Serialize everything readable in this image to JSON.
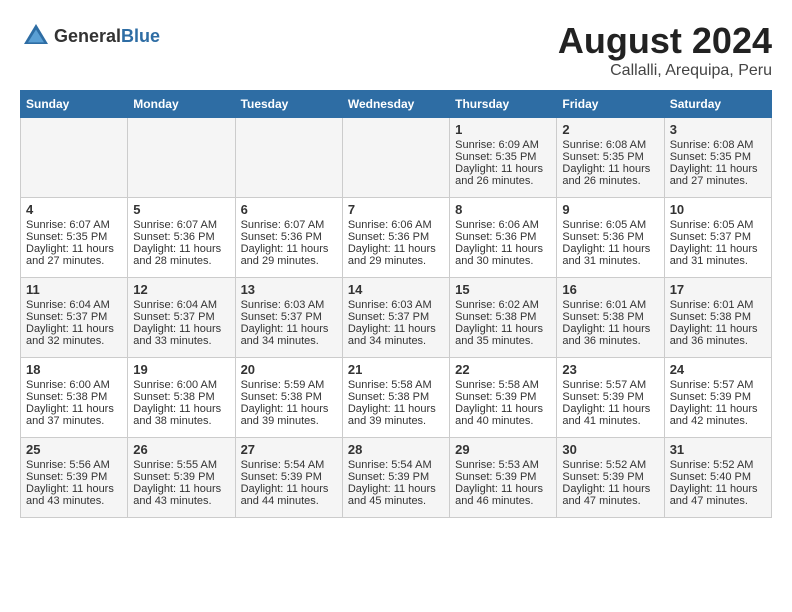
{
  "header": {
    "logo_general": "General",
    "logo_blue": "Blue",
    "month_year": "August 2024",
    "location": "Callalli, Arequipa, Peru"
  },
  "weekdays": [
    "Sunday",
    "Monday",
    "Tuesday",
    "Wednesday",
    "Thursday",
    "Friday",
    "Saturday"
  ],
  "weeks": [
    [
      {
        "day": "",
        "sunrise": "",
        "sunset": "",
        "daylight": ""
      },
      {
        "day": "",
        "sunrise": "",
        "sunset": "",
        "daylight": ""
      },
      {
        "day": "",
        "sunrise": "",
        "sunset": "",
        "daylight": ""
      },
      {
        "day": "",
        "sunrise": "",
        "sunset": "",
        "daylight": ""
      },
      {
        "day": "1",
        "sunrise": "Sunrise: 6:09 AM",
        "sunset": "Sunset: 5:35 PM",
        "daylight": "Daylight: 11 hours and 26 minutes."
      },
      {
        "day": "2",
        "sunrise": "Sunrise: 6:08 AM",
        "sunset": "Sunset: 5:35 PM",
        "daylight": "Daylight: 11 hours and 26 minutes."
      },
      {
        "day": "3",
        "sunrise": "Sunrise: 6:08 AM",
        "sunset": "Sunset: 5:35 PM",
        "daylight": "Daylight: 11 hours and 27 minutes."
      }
    ],
    [
      {
        "day": "4",
        "sunrise": "Sunrise: 6:07 AM",
        "sunset": "Sunset: 5:35 PM",
        "daylight": "Daylight: 11 hours and 27 minutes."
      },
      {
        "day": "5",
        "sunrise": "Sunrise: 6:07 AM",
        "sunset": "Sunset: 5:36 PM",
        "daylight": "Daylight: 11 hours and 28 minutes."
      },
      {
        "day": "6",
        "sunrise": "Sunrise: 6:07 AM",
        "sunset": "Sunset: 5:36 PM",
        "daylight": "Daylight: 11 hours and 29 minutes."
      },
      {
        "day": "7",
        "sunrise": "Sunrise: 6:06 AM",
        "sunset": "Sunset: 5:36 PM",
        "daylight": "Daylight: 11 hours and 29 minutes."
      },
      {
        "day": "8",
        "sunrise": "Sunrise: 6:06 AM",
        "sunset": "Sunset: 5:36 PM",
        "daylight": "Daylight: 11 hours and 30 minutes."
      },
      {
        "day": "9",
        "sunrise": "Sunrise: 6:05 AM",
        "sunset": "Sunset: 5:36 PM",
        "daylight": "Daylight: 11 hours and 31 minutes."
      },
      {
        "day": "10",
        "sunrise": "Sunrise: 6:05 AM",
        "sunset": "Sunset: 5:37 PM",
        "daylight": "Daylight: 11 hours and 31 minutes."
      }
    ],
    [
      {
        "day": "11",
        "sunrise": "Sunrise: 6:04 AM",
        "sunset": "Sunset: 5:37 PM",
        "daylight": "Daylight: 11 hours and 32 minutes."
      },
      {
        "day": "12",
        "sunrise": "Sunrise: 6:04 AM",
        "sunset": "Sunset: 5:37 PM",
        "daylight": "Daylight: 11 hours and 33 minutes."
      },
      {
        "day": "13",
        "sunrise": "Sunrise: 6:03 AM",
        "sunset": "Sunset: 5:37 PM",
        "daylight": "Daylight: 11 hours and 34 minutes."
      },
      {
        "day": "14",
        "sunrise": "Sunrise: 6:03 AM",
        "sunset": "Sunset: 5:37 PM",
        "daylight": "Daylight: 11 hours and 34 minutes."
      },
      {
        "day": "15",
        "sunrise": "Sunrise: 6:02 AM",
        "sunset": "Sunset: 5:38 PM",
        "daylight": "Daylight: 11 hours and 35 minutes."
      },
      {
        "day": "16",
        "sunrise": "Sunrise: 6:01 AM",
        "sunset": "Sunset: 5:38 PM",
        "daylight": "Daylight: 11 hours and 36 minutes."
      },
      {
        "day": "17",
        "sunrise": "Sunrise: 6:01 AM",
        "sunset": "Sunset: 5:38 PM",
        "daylight": "Daylight: 11 hours and 36 minutes."
      }
    ],
    [
      {
        "day": "18",
        "sunrise": "Sunrise: 6:00 AM",
        "sunset": "Sunset: 5:38 PM",
        "daylight": "Daylight: 11 hours and 37 minutes."
      },
      {
        "day": "19",
        "sunrise": "Sunrise: 6:00 AM",
        "sunset": "Sunset: 5:38 PM",
        "daylight": "Daylight: 11 hours and 38 minutes."
      },
      {
        "day": "20",
        "sunrise": "Sunrise: 5:59 AM",
        "sunset": "Sunset: 5:38 PM",
        "daylight": "Daylight: 11 hours and 39 minutes."
      },
      {
        "day": "21",
        "sunrise": "Sunrise: 5:58 AM",
        "sunset": "Sunset: 5:38 PM",
        "daylight": "Daylight: 11 hours and 39 minutes."
      },
      {
        "day": "22",
        "sunrise": "Sunrise: 5:58 AM",
        "sunset": "Sunset: 5:39 PM",
        "daylight": "Daylight: 11 hours and 40 minutes."
      },
      {
        "day": "23",
        "sunrise": "Sunrise: 5:57 AM",
        "sunset": "Sunset: 5:39 PM",
        "daylight": "Daylight: 11 hours and 41 minutes."
      },
      {
        "day": "24",
        "sunrise": "Sunrise: 5:57 AM",
        "sunset": "Sunset: 5:39 PM",
        "daylight": "Daylight: 11 hours and 42 minutes."
      }
    ],
    [
      {
        "day": "25",
        "sunrise": "Sunrise: 5:56 AM",
        "sunset": "Sunset: 5:39 PM",
        "daylight": "Daylight: 11 hours and 43 minutes."
      },
      {
        "day": "26",
        "sunrise": "Sunrise: 5:55 AM",
        "sunset": "Sunset: 5:39 PM",
        "daylight": "Daylight: 11 hours and 43 minutes."
      },
      {
        "day": "27",
        "sunrise": "Sunrise: 5:54 AM",
        "sunset": "Sunset: 5:39 PM",
        "daylight": "Daylight: 11 hours and 44 minutes."
      },
      {
        "day": "28",
        "sunrise": "Sunrise: 5:54 AM",
        "sunset": "Sunset: 5:39 PM",
        "daylight": "Daylight: 11 hours and 45 minutes."
      },
      {
        "day": "29",
        "sunrise": "Sunrise: 5:53 AM",
        "sunset": "Sunset: 5:39 PM",
        "daylight": "Daylight: 11 hours and 46 minutes."
      },
      {
        "day": "30",
        "sunrise": "Sunrise: 5:52 AM",
        "sunset": "Sunset: 5:39 PM",
        "daylight": "Daylight: 11 hours and 47 minutes."
      },
      {
        "day": "31",
        "sunrise": "Sunrise: 5:52 AM",
        "sunset": "Sunset: 5:40 PM",
        "daylight": "Daylight: 11 hours and 47 minutes."
      }
    ]
  ]
}
